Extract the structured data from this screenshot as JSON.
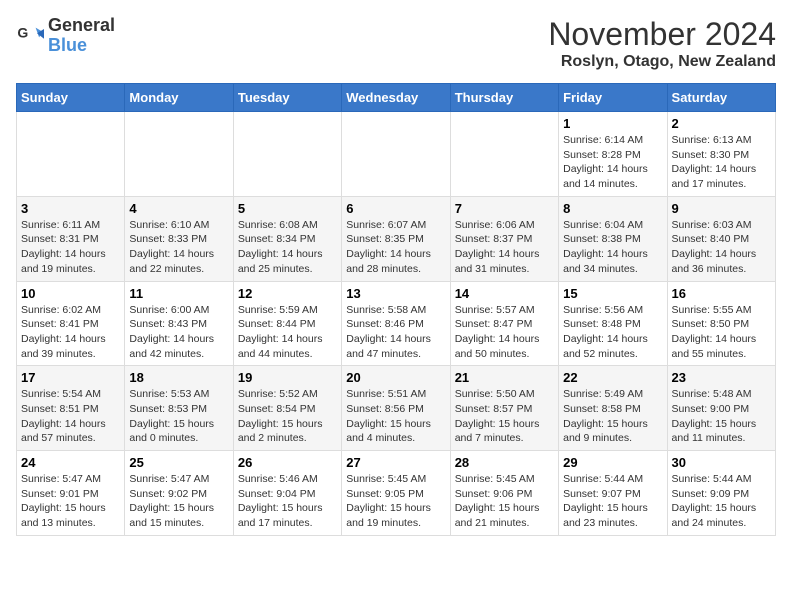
{
  "logo": {
    "line1": "General",
    "line2": "Blue"
  },
  "title": "November 2024",
  "location": "Roslyn, Otago, New Zealand",
  "days_of_week": [
    "Sunday",
    "Monday",
    "Tuesday",
    "Wednesday",
    "Thursday",
    "Friday",
    "Saturday"
  ],
  "weeks": [
    [
      {
        "day": "",
        "info": ""
      },
      {
        "day": "",
        "info": ""
      },
      {
        "day": "",
        "info": ""
      },
      {
        "day": "",
        "info": ""
      },
      {
        "day": "",
        "info": ""
      },
      {
        "day": "1",
        "info": "Sunrise: 6:14 AM\nSunset: 8:28 PM\nDaylight: 14 hours and 14 minutes."
      },
      {
        "day": "2",
        "info": "Sunrise: 6:13 AM\nSunset: 8:30 PM\nDaylight: 14 hours and 17 minutes."
      }
    ],
    [
      {
        "day": "3",
        "info": "Sunrise: 6:11 AM\nSunset: 8:31 PM\nDaylight: 14 hours and 19 minutes."
      },
      {
        "day": "4",
        "info": "Sunrise: 6:10 AM\nSunset: 8:33 PM\nDaylight: 14 hours and 22 minutes."
      },
      {
        "day": "5",
        "info": "Sunrise: 6:08 AM\nSunset: 8:34 PM\nDaylight: 14 hours and 25 minutes."
      },
      {
        "day": "6",
        "info": "Sunrise: 6:07 AM\nSunset: 8:35 PM\nDaylight: 14 hours and 28 minutes."
      },
      {
        "day": "7",
        "info": "Sunrise: 6:06 AM\nSunset: 8:37 PM\nDaylight: 14 hours and 31 minutes."
      },
      {
        "day": "8",
        "info": "Sunrise: 6:04 AM\nSunset: 8:38 PM\nDaylight: 14 hours and 34 minutes."
      },
      {
        "day": "9",
        "info": "Sunrise: 6:03 AM\nSunset: 8:40 PM\nDaylight: 14 hours and 36 minutes."
      }
    ],
    [
      {
        "day": "10",
        "info": "Sunrise: 6:02 AM\nSunset: 8:41 PM\nDaylight: 14 hours and 39 minutes."
      },
      {
        "day": "11",
        "info": "Sunrise: 6:00 AM\nSunset: 8:43 PM\nDaylight: 14 hours and 42 minutes."
      },
      {
        "day": "12",
        "info": "Sunrise: 5:59 AM\nSunset: 8:44 PM\nDaylight: 14 hours and 44 minutes."
      },
      {
        "day": "13",
        "info": "Sunrise: 5:58 AM\nSunset: 8:46 PM\nDaylight: 14 hours and 47 minutes."
      },
      {
        "day": "14",
        "info": "Sunrise: 5:57 AM\nSunset: 8:47 PM\nDaylight: 14 hours and 50 minutes."
      },
      {
        "day": "15",
        "info": "Sunrise: 5:56 AM\nSunset: 8:48 PM\nDaylight: 14 hours and 52 minutes."
      },
      {
        "day": "16",
        "info": "Sunrise: 5:55 AM\nSunset: 8:50 PM\nDaylight: 14 hours and 55 minutes."
      }
    ],
    [
      {
        "day": "17",
        "info": "Sunrise: 5:54 AM\nSunset: 8:51 PM\nDaylight: 14 hours and 57 minutes."
      },
      {
        "day": "18",
        "info": "Sunrise: 5:53 AM\nSunset: 8:53 PM\nDaylight: 15 hours and 0 minutes."
      },
      {
        "day": "19",
        "info": "Sunrise: 5:52 AM\nSunset: 8:54 PM\nDaylight: 15 hours and 2 minutes."
      },
      {
        "day": "20",
        "info": "Sunrise: 5:51 AM\nSunset: 8:56 PM\nDaylight: 15 hours and 4 minutes."
      },
      {
        "day": "21",
        "info": "Sunrise: 5:50 AM\nSunset: 8:57 PM\nDaylight: 15 hours and 7 minutes."
      },
      {
        "day": "22",
        "info": "Sunrise: 5:49 AM\nSunset: 8:58 PM\nDaylight: 15 hours and 9 minutes."
      },
      {
        "day": "23",
        "info": "Sunrise: 5:48 AM\nSunset: 9:00 PM\nDaylight: 15 hours and 11 minutes."
      }
    ],
    [
      {
        "day": "24",
        "info": "Sunrise: 5:47 AM\nSunset: 9:01 PM\nDaylight: 15 hours and 13 minutes."
      },
      {
        "day": "25",
        "info": "Sunrise: 5:47 AM\nSunset: 9:02 PM\nDaylight: 15 hours and 15 minutes."
      },
      {
        "day": "26",
        "info": "Sunrise: 5:46 AM\nSunset: 9:04 PM\nDaylight: 15 hours and 17 minutes."
      },
      {
        "day": "27",
        "info": "Sunrise: 5:45 AM\nSunset: 9:05 PM\nDaylight: 15 hours and 19 minutes."
      },
      {
        "day": "28",
        "info": "Sunrise: 5:45 AM\nSunset: 9:06 PM\nDaylight: 15 hours and 21 minutes."
      },
      {
        "day": "29",
        "info": "Sunrise: 5:44 AM\nSunset: 9:07 PM\nDaylight: 15 hours and 23 minutes."
      },
      {
        "day": "30",
        "info": "Sunrise: 5:44 AM\nSunset: 9:09 PM\nDaylight: 15 hours and 24 minutes."
      }
    ]
  ]
}
